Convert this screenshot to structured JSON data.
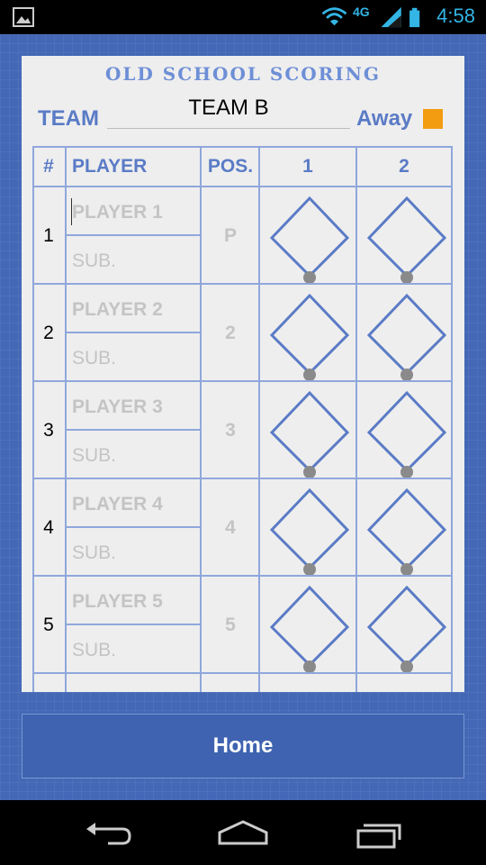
{
  "status_bar": {
    "time": "4:58",
    "network": "4G",
    "icons": [
      "gallery-icon",
      "wifi-icon",
      "signal-icon",
      "battery-icon"
    ]
  },
  "sheet": {
    "title": "OLD SCHOOL SCORING",
    "team_label": "TEAM",
    "team_name": "TEAM B",
    "away_label": "Away",
    "away_color": "#f39c12",
    "columns": [
      "#",
      "PLAYER",
      "POS.",
      "1",
      "2"
    ],
    "rows": [
      {
        "num": "1",
        "player": "PLAYER 1",
        "sub": "SUB.",
        "pos": "P"
      },
      {
        "num": "2",
        "player": "PLAYER 2",
        "sub": "SUB.",
        "pos": "2"
      },
      {
        "num": "3",
        "player": "PLAYER 3",
        "sub": "SUB.",
        "pos": "3"
      },
      {
        "num": "4",
        "player": "PLAYER 4",
        "sub": "SUB.",
        "pos": "4"
      },
      {
        "num": "5",
        "player": "PLAYER 5",
        "sub": "SUB.",
        "pos": "5"
      }
    ]
  },
  "home_button": {
    "label": "Home"
  },
  "nav": [
    "back-icon",
    "home-icon",
    "recent-apps-icon"
  ],
  "colors": {
    "accent": "#5a7bc6",
    "background": "#4468b6",
    "diamond": "#5a7bc6"
  }
}
